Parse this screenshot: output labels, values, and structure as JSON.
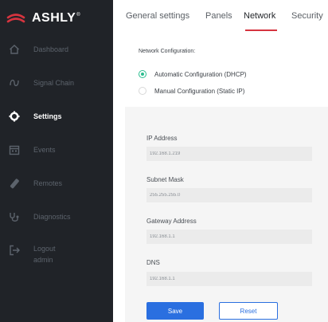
{
  "brand": {
    "name": "ASHLY",
    "reg": "®",
    "accent": "#d6343f"
  },
  "sidebar": {
    "items": [
      {
        "label": "Dashboard",
        "icon": "home-icon"
      },
      {
        "label": "Signal Chain",
        "icon": "signal-chain-icon"
      },
      {
        "label": "Settings",
        "icon": "gear-icon",
        "active": true
      },
      {
        "label": "Events",
        "icon": "calendar-icon"
      },
      {
        "label": "Remotes",
        "icon": "remote-icon"
      },
      {
        "label": "Diagnostics",
        "icon": "stethoscope-icon"
      },
      {
        "label": "Logout",
        "sub": "admin",
        "icon": "logout-icon"
      }
    ]
  },
  "tabs": [
    {
      "label": "General settings"
    },
    {
      "label": "Panels"
    },
    {
      "label": "Network",
      "active": true
    },
    {
      "label": "Security"
    }
  ],
  "network": {
    "section_title": "Network Configuration:",
    "options": [
      {
        "label": "Automatic Configuration (DHCP)",
        "checked": true
      },
      {
        "label": "Manual Configuration (Static IP)",
        "checked": false
      }
    ],
    "fields": [
      {
        "label": "IP Address",
        "value": "192.168.1.219"
      },
      {
        "label": "Subnet Mask",
        "value": "255.255.255.0"
      },
      {
        "label": "Gateway Address",
        "value": "192.168.1.1"
      },
      {
        "label": "DNS",
        "value": "192.168.1.1"
      }
    ]
  },
  "actions": {
    "save": "Save",
    "reset": "Reset"
  },
  "colors": {
    "sidebar_bg": "#202328",
    "primary": "#2a6fe0",
    "radio_checked": "#2bbd8f"
  }
}
